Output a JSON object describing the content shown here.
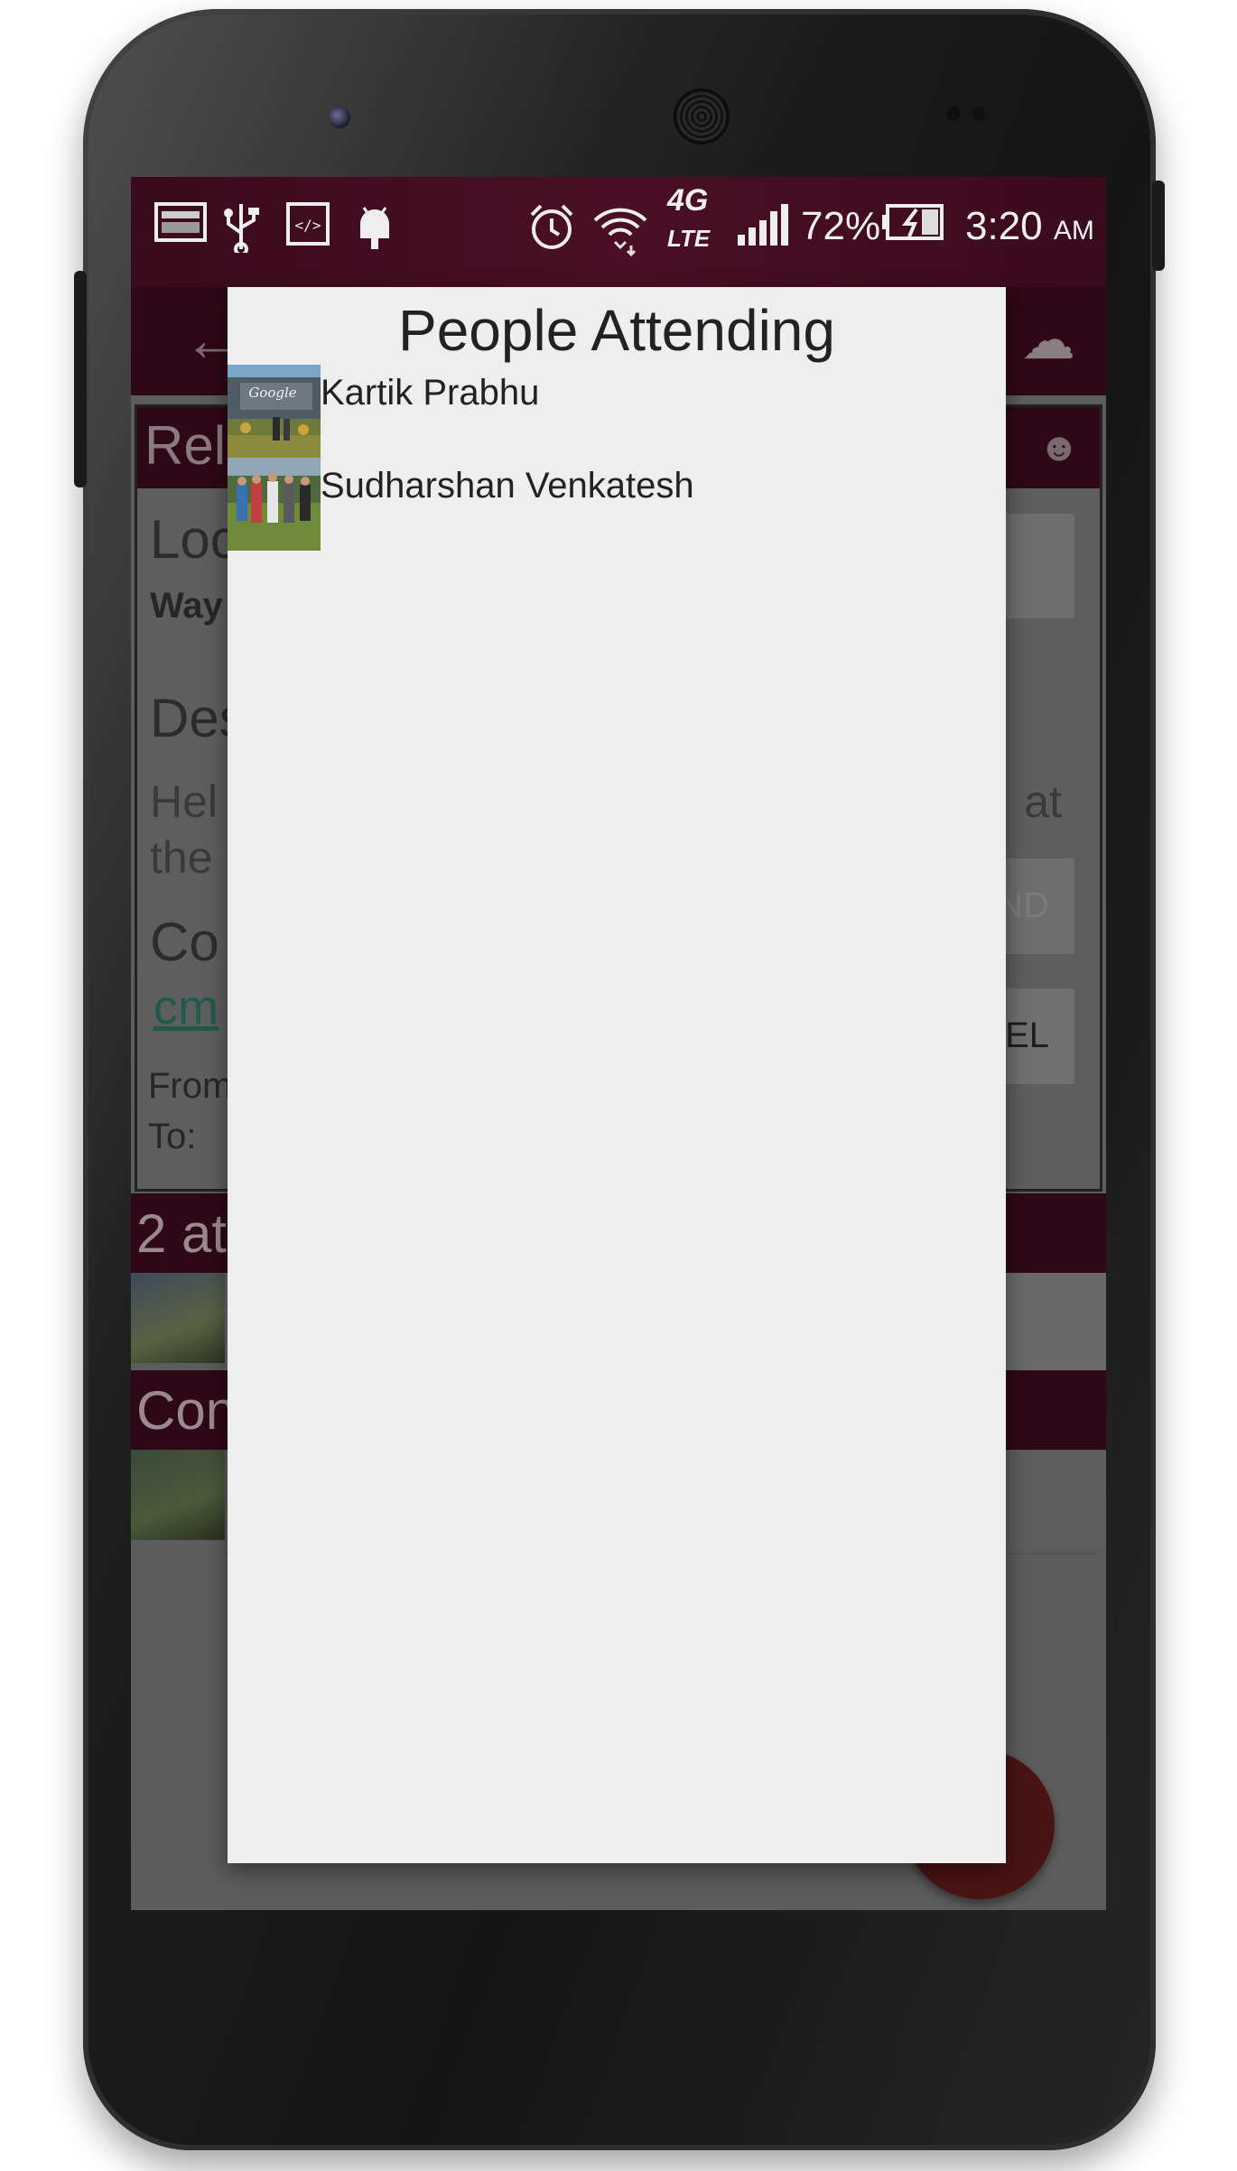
{
  "status_bar": {
    "battery": "72%",
    "network": "4G",
    "network_sub": "LTE",
    "time": "3:20",
    "meridiem": "AM",
    "icons": [
      "image-notification-icon",
      "usb-icon",
      "developer-icon",
      "android-icon",
      "alarm-icon",
      "wifi-icon",
      "signal-icon",
      "battery-charging-icon"
    ]
  },
  "background": {
    "card_title_partial": "Rel",
    "location_partial": "Loc",
    "location_value_partial": "Way",
    "description_partial": "Des",
    "description_text_partial": "Hel",
    "description_text_right": "at",
    "description_text_line2": "the",
    "contact_partial": "Co",
    "contact_link_partial": "cm",
    "from_label": "From",
    "to_label": "To:",
    "button1_partial": "ND",
    "button2_partial": "EL",
    "attending_strip_partial": "2 at",
    "comments_strip_partial": "Con"
  },
  "dialog": {
    "title": "People Attending",
    "attendees": [
      {
        "name": "Kartik Prabhu",
        "avatar": "google-campus-photo"
      },
      {
        "name": "Sudharshan Venkatesh",
        "avatar": "group-outdoor-photo"
      }
    ]
  },
  "colors": {
    "accent": "#4a0f24",
    "dialog_bg": "#eeeeee",
    "scrim": "#5c5c5c",
    "fab": "#4a1414"
  }
}
